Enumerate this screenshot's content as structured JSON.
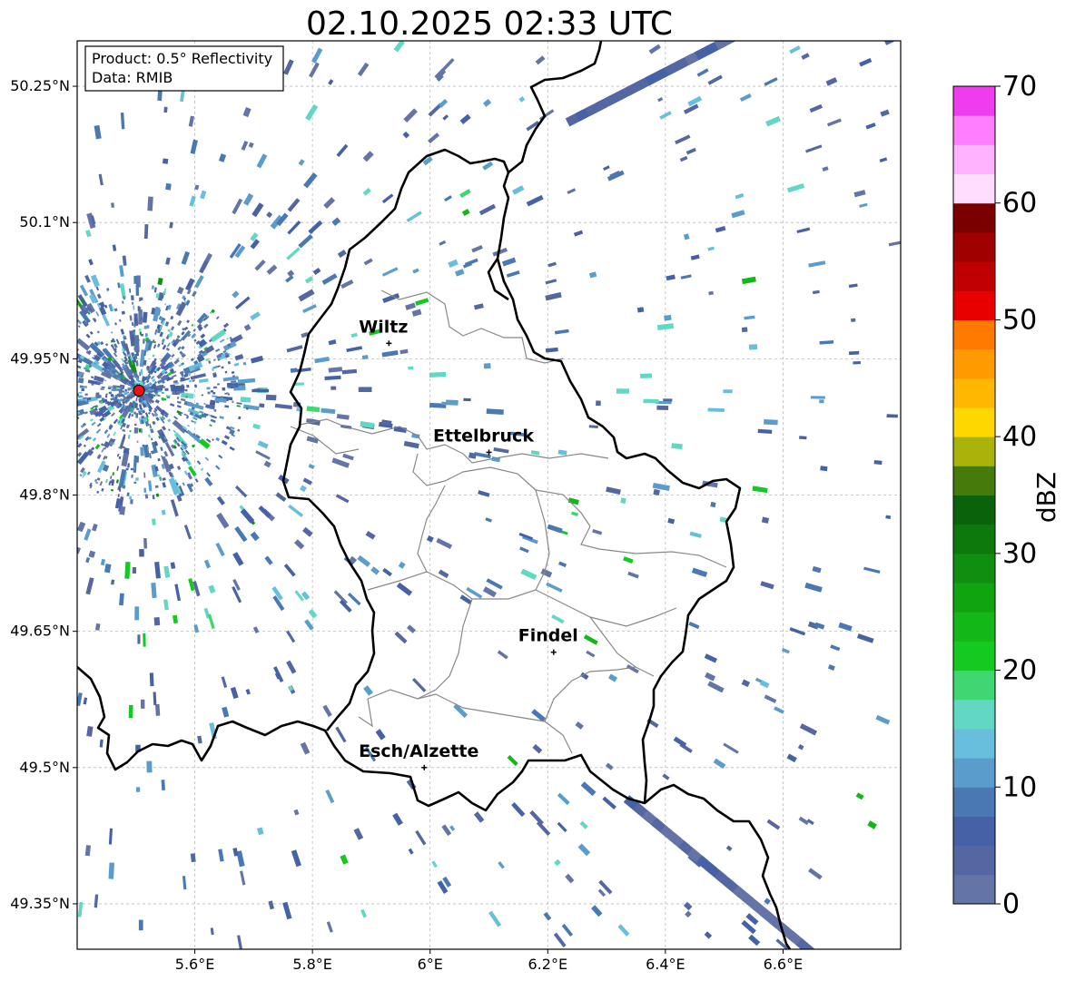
{
  "title": "02.10.2025 02:33 UTC",
  "info_box": {
    "product": "Product: 0.5° Reflectivity",
    "data_source": "Data: RMIB"
  },
  "lat_labels": [
    "50.25°N",
    "50.1°N",
    "49.95°N",
    "49.8°N",
    "49.65°N",
    "49.5°N",
    "49.35°N"
  ],
  "lon_labels": [
    "5.6°E",
    "5.8°E",
    "6°E",
    "6.2°E",
    "6.4°E",
    "6.6°E"
  ],
  "cities": [
    {
      "name": "Wiltz",
      "lon": 5.93,
      "lat": 49.967
    },
    {
      "name": "Ettelbruck",
      "lon": 6.1,
      "lat": 49.847
    },
    {
      "name": "Findel",
      "lon": 6.21,
      "lat": 49.627
    },
    {
      "name": "Esch/Alzette",
      "lon": 5.99,
      "lat": 49.5
    }
  ],
  "radar_site": {
    "lon": 5.505,
    "lat": 49.915,
    "color": "#ee1111"
  },
  "map_extent": {
    "lon": [
      5.4,
      6.8
    ],
    "lat": [
      49.3,
      50.3
    ]
  },
  "colorbar": {
    "label": "dBZ",
    "ticks": [
      "0",
      "10",
      "20",
      "30",
      "40",
      "50",
      "60",
      "70"
    ],
    "min": 0,
    "max": 70,
    "step": 2.5,
    "colors": [
      "#6474a6",
      "#5567a2",
      "#4661a6",
      "#4a78b2",
      "#5a9ccb",
      "#67bfdd",
      "#62d7c3",
      "#3ed772",
      "#14c920",
      "#13b818",
      "#11a411",
      "#108e10",
      "#0d790d",
      "#0a620a",
      "#467a0a",
      "#aab30a",
      "#ffd700",
      "#ffb700",
      "#ff9a00",
      "#ff7a00",
      "#e80000",
      "#c00000",
      "#a00000",
      "#7a0000",
      "#ffddff",
      "#ffb2ff",
      "#ff7dff",
      "#ee3cee"
    ]
  }
}
